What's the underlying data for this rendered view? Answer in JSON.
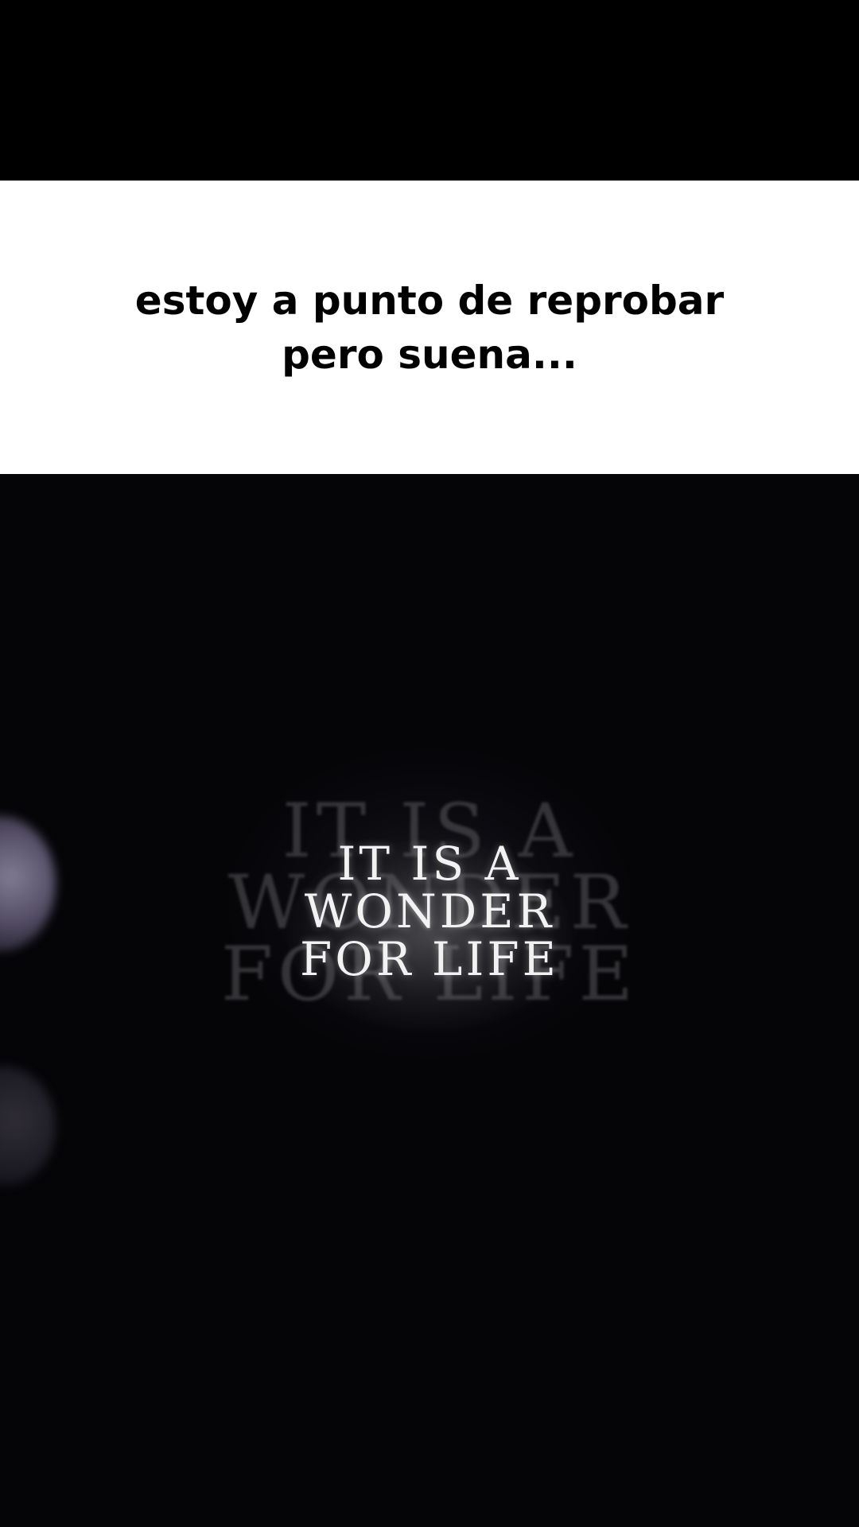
{
  "caption": {
    "lines": [
      "estoy a punto de reprobar",
      "pero suena..."
    ]
  },
  "video": {
    "lyric_lines": [
      "IT IS A",
      "WONDER",
      "FOR LIFE"
    ],
    "background_lyric_lines": [
      "IT IS A",
      "WONDER",
      "FOR LIFE"
    ]
  },
  "colors": {
    "caption_background": "#ffffff",
    "caption_text": "#000000",
    "video_background": "#0b0b10",
    "lyric_text": "#f2f2f2"
  }
}
